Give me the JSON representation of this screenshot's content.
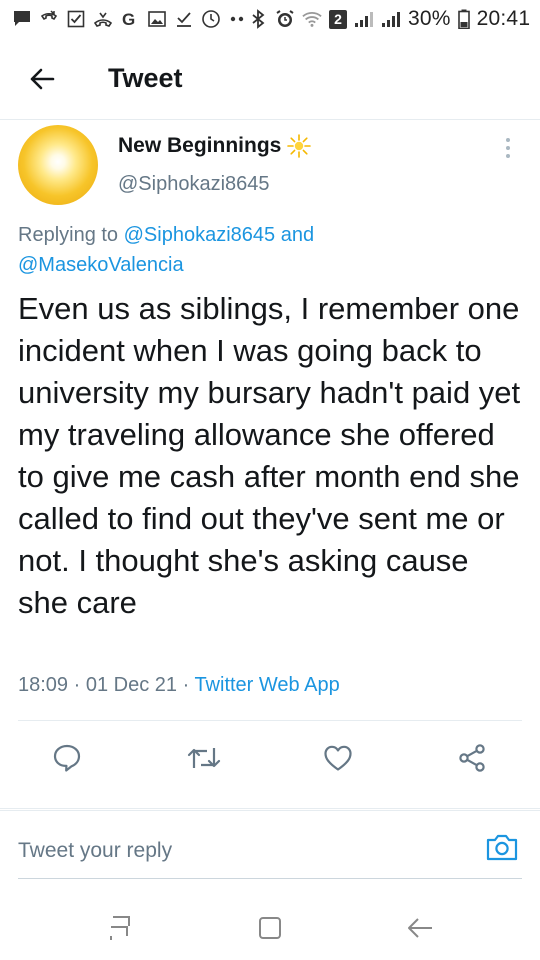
{
  "status_bar": {
    "battery_percent": "30%",
    "time": "20:41",
    "sim_badge": "2"
  },
  "header": {
    "title": "Tweet"
  },
  "tweet": {
    "author": {
      "name": "New Beginnings",
      "handle": "@Siphokazi8645",
      "name_emoji": "☀"
    },
    "replying_prefix": "Replying to ",
    "replying_mention_1": "@Siphokazi8645",
    "replying_and": " and",
    "replying_mention_2": "@MasekoValencia",
    "text": "Even us as siblings, I remember one incident when I was going back to university my bursary hadn't paid yet my traveling allowance she offered to give me cash after month end she called to find out they've sent me or not. I thought she's asking cause she care",
    "time": "18:09",
    "date": "01 Dec 21",
    "separator": " · ",
    "source": "Twitter Web App"
  },
  "actions": {
    "reply_icon": "reply-icon",
    "retweet_icon": "retweet-icon",
    "like_icon": "heart-icon",
    "share_icon": "share-icon"
  },
  "reply_bar": {
    "placeholder": "Tweet your reply"
  },
  "colors": {
    "accent": "#1b95e0",
    "text_secondary": "#657786",
    "text_primary": "#14171a",
    "divider": "#e6ecf0"
  }
}
